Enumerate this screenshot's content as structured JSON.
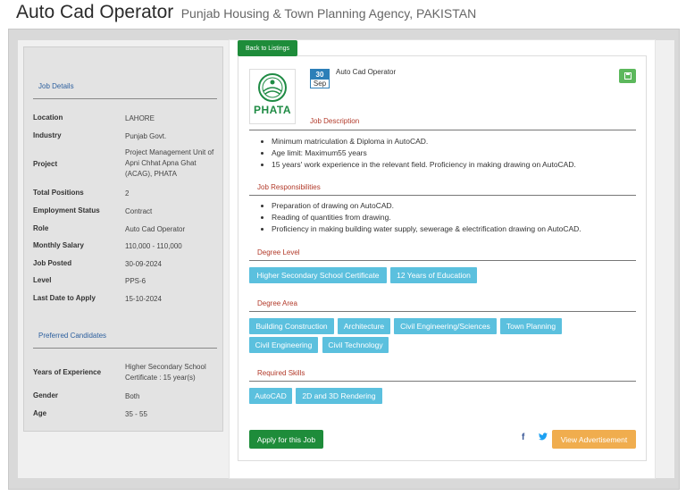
{
  "header": {
    "title": "Auto Cad Operator",
    "subtitle": "Punjab Housing & Town Planning Agency, PAKISTAN"
  },
  "details": {
    "section_title": "Job Details",
    "rows": [
      {
        "label": "Location",
        "value": "LAHORE"
      },
      {
        "label": "Industry",
        "value": "Punjab Govt."
      },
      {
        "label": "Project",
        "value": "Project Management Unit of Apni Chhat Apna Ghat (ACAG), PHATA"
      },
      {
        "label": "Total Positions",
        "value": "2"
      },
      {
        "label": "Employment Status",
        "value": "Contract"
      },
      {
        "label": "Role",
        "value": "Auto Cad Operator"
      },
      {
        "label": "Monthly Salary",
        "value": "110,000 - 110,000"
      },
      {
        "label": "Job Posted",
        "value": "30-09-2024"
      },
      {
        "label": "Level",
        "value": "PPS-6"
      },
      {
        "label": "Last Date to Apply",
        "value": "15-10-2024"
      }
    ]
  },
  "preferred": {
    "section_title": "Preferred Candidates",
    "rows": [
      {
        "label": "Years of Experience",
        "value": "Higher Secondary School Certificate : 15 year(s)"
      },
      {
        "label": "Gender",
        "value": "Both"
      },
      {
        "label": "Age",
        "value": "35 - 55"
      }
    ]
  },
  "card": {
    "back_label": "Back to Listings",
    "logo_text": "PHATA",
    "date_day": "30",
    "date_month": "Sep",
    "title": "Auto Cad Operator",
    "save_icon": "save-icon",
    "description_heading": "Job Description",
    "description": [
      "Minimum matriculation & Diploma in AutoCAD.",
      "Age limit: Maximum55 years",
      "15 years' work experience in the relevant field. Proficiency in making drawing on AutoCAD."
    ],
    "responsibilities_heading": "Job Responsibilities",
    "responsibilities": [
      "Preparation of drawing on AutoCAD.",
      "Reading of quantities from drawing.",
      "Proficiency in making building  water supply, sewerage & electrification drawing on AutoCAD."
    ],
    "degree_level_heading": "Degree Level",
    "degree_levels": [
      "Higher Secondary School Certificate",
      "12 Years of Education"
    ],
    "degree_area_heading": "Degree Area",
    "degree_areas": [
      "Building Construction",
      "Architecture",
      "Civil Engineering/Sciences",
      "Town Planning",
      "Civil Engineering",
      "Civil Technology"
    ],
    "skills_heading": "Required Skills",
    "skills": [
      "AutoCAD",
      "2D and 3D Rendering"
    ],
    "apply_label": "Apply for this Job",
    "facebook_glyph": "f",
    "twitter_glyph": "🐦",
    "view_label": "View Advertisement"
  },
  "colors": {
    "accent_green": "#1e8c3a",
    "tag_blue": "#5bc0de",
    "heading_red": "#b23a2a",
    "view_orange": "#f0ad4e"
  }
}
